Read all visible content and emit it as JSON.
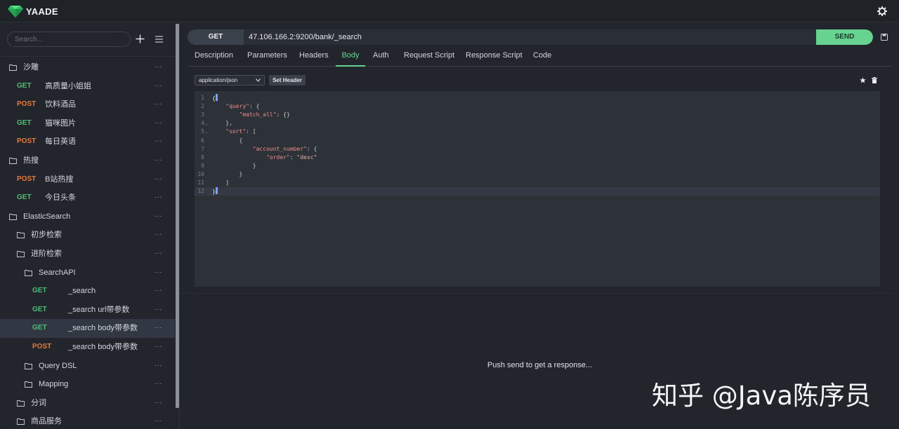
{
  "app": {
    "title": "YAADE"
  },
  "sidebar": {
    "search_placeholder": "Search...",
    "items": [
      {
        "type": "folder",
        "label": "沙雕"
      },
      {
        "type": "request",
        "method": "GET",
        "label": "高质量小姐姐"
      },
      {
        "type": "request",
        "method": "POST",
        "label": "饮料酒品"
      },
      {
        "type": "request",
        "method": "GET",
        "label": "猫咪图片"
      },
      {
        "type": "request",
        "method": "POST",
        "label": "每日英语"
      },
      {
        "type": "folder",
        "label": "热搜"
      },
      {
        "type": "request",
        "method": "POST",
        "label": "B站热搜"
      },
      {
        "type": "request",
        "method": "GET",
        "label": "今日头条"
      },
      {
        "type": "folder",
        "label": "ElasticSearch"
      },
      {
        "type": "folder",
        "label": "初步检索"
      },
      {
        "type": "folder",
        "label": "进阶检索"
      },
      {
        "type": "folder",
        "label": "SearchAPI"
      },
      {
        "type": "request",
        "method": "GET",
        "label": "_search"
      },
      {
        "type": "request",
        "method": "GET",
        "label": "_search url带参数"
      },
      {
        "type": "request",
        "method": "GET",
        "label": "_search body带参数"
      },
      {
        "type": "request",
        "method": "POST",
        "label": "_search body带参数"
      },
      {
        "type": "folder",
        "label": "Query DSL"
      },
      {
        "type": "folder",
        "label": "Mapping"
      },
      {
        "type": "folder",
        "label": "分词"
      },
      {
        "type": "folder",
        "label": "商品服务"
      }
    ],
    "more_label": "···"
  },
  "request": {
    "method": "GET",
    "url": "47.106.166.2:9200/bank/_search",
    "send_label": "SEND"
  },
  "tabs": [
    "Description",
    "Parameters",
    "Headers",
    "Body",
    "Auth",
    "Request Script",
    "Response Script",
    "Code"
  ],
  "active_tab": "Body",
  "body": {
    "content_type": "application/json",
    "set_header_label": "Set Header",
    "line_numbers": [
      "1",
      "2",
      "3",
      "4",
      "5",
      "6",
      "7",
      "8",
      "9",
      "10",
      "11",
      "12"
    ],
    "code_lines": [
      "{",
      "    \"query\": {",
      "        \"match_all\": {}",
      "    },",
      "    \"sort\": [",
      "        {",
      "            \"account_number\": {",
      "                \"order\": \"desc\"",
      "            }",
      "        }",
      "    ]",
      "}"
    ]
  },
  "response": {
    "hint": "Push send to get a response..."
  },
  "watermark": "知乎 @Java陈序员",
  "colors": {
    "get": "#4fbf78",
    "post": "#e9783e",
    "send": "#68d391",
    "accent": "#68d391",
    "background": "#22252b"
  },
  "icons": [
    "logo-gem-icon",
    "gear-icon",
    "plus-icon",
    "menu-icon",
    "folder-open-icon",
    "folder-icon",
    "save-icon",
    "star-icon",
    "trash-icon",
    "chevron-down-icon"
  ]
}
